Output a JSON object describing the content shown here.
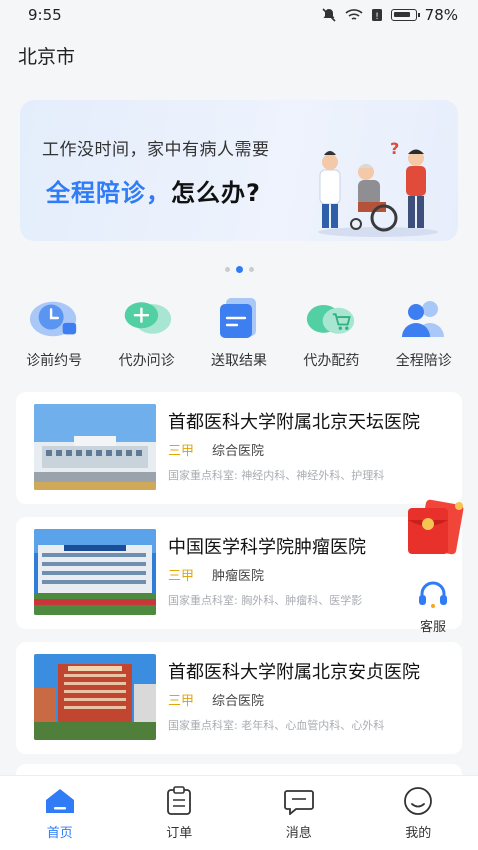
{
  "status_bar": {
    "time": "9:55",
    "battery": "78%"
  },
  "city": "北京市",
  "banner": {
    "line1": "工作没时间，家中有病人需要",
    "highlight": "全程陪诊，",
    "question": "怎么办?"
  },
  "carousel": {
    "count": 3,
    "active_index": 1
  },
  "services": [
    {
      "label": "诊前约号",
      "icon": "clock-icon"
    },
    {
      "label": "代办问诊",
      "icon": "chat-plus-icon"
    },
    {
      "label": "送取结果",
      "icon": "card-icon"
    },
    {
      "label": "代办配药",
      "icon": "cart-icon"
    },
    {
      "label": "全程陪诊",
      "icon": "people-icon"
    }
  ],
  "hospitals": [
    {
      "name": "首都医科大学附属北京天坛医院",
      "grade": "三甲",
      "type": "综合医院",
      "departments": "国家重点科室: 神经内科、神经外科、护理科"
    },
    {
      "name": "中国医学科学院肿瘤医院",
      "grade": "三甲",
      "type": "肿瘤医院",
      "departments": "国家重点科室: 胸外科、肿瘤科、医学影"
    },
    {
      "name": "首都医科大学附属北京安贞医院",
      "grade": "三甲",
      "type": "综合医院",
      "departments": "国家重点科室: 老年科、心血管内科、心外科"
    }
  ],
  "float_buttons": {
    "customer_service": "客服"
  },
  "tabbar": [
    {
      "label": "首页",
      "icon": "home-icon",
      "active": true
    },
    {
      "label": "订单",
      "icon": "clipboard-icon",
      "active": false
    },
    {
      "label": "消息",
      "icon": "message-icon",
      "active": false
    },
    {
      "label": "我的",
      "icon": "profile-icon",
      "active": false
    }
  ],
  "colors": {
    "accent": "#2f7cf6",
    "grade": "#e0a60a",
    "background": "#f5f6f8"
  }
}
